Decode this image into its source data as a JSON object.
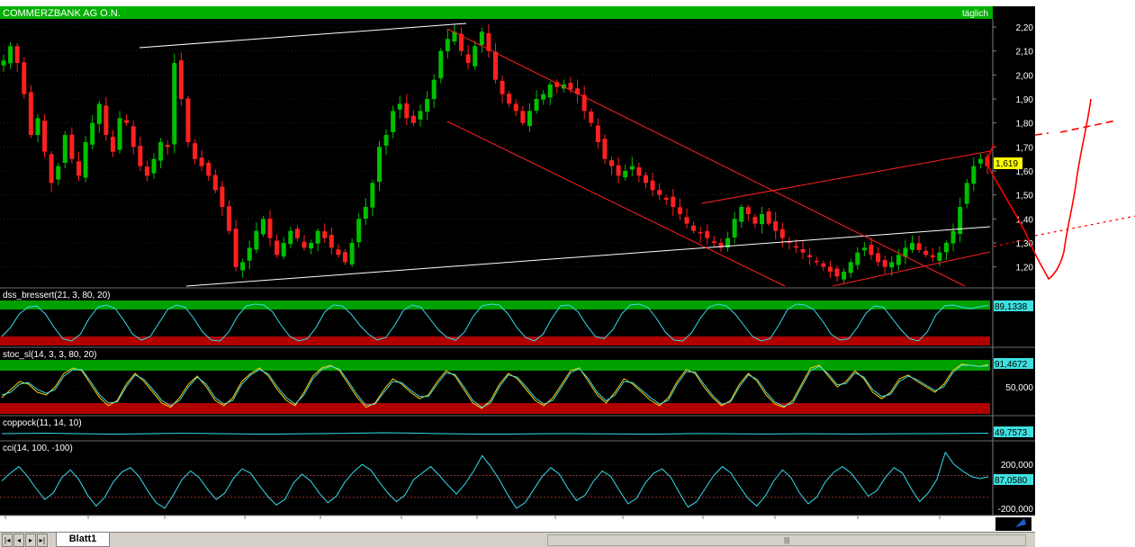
{
  "window": {
    "symbol": "COMMERZBANK AG O.N.",
    "period": "täglich"
  },
  "colors": {
    "background": "#000000",
    "up_candle": "#00c000",
    "down_candle": "#ff2020",
    "trend_red": "#ff2020",
    "trend_white": "#ffffff",
    "indicator": "#33ddee",
    "zone_green": "#00a000",
    "zone_red": "#b00000",
    "header": "#00c000",
    "handdrawn": "#ff0000"
  },
  "chart_data": [
    {
      "type": "candlestick",
      "title": "COMMERZBANK AG O.N.",
      "x_labels": [
        "11",
        "Okt",
        "Nov",
        "Dez",
        "'12",
        "Feb",
        "Mrz",
        "Apr",
        "Mai",
        "Jun",
        "Jul",
        "Aug",
        "Sep"
      ],
      "y_ticks": [
        "2,20",
        "2,10",
        "2,00",
        "1,90",
        "1,80",
        "1,70",
        "1,60",
        "1,50",
        "1,40",
        "1,30",
        "1,20"
      ],
      "ylim": [
        1.12,
        2.23
      ],
      "last_value": "1,619",
      "close_series": [
        2.06,
        2.12,
        2.05,
        1.92,
        1.75,
        1.82,
        1.68,
        1.55,
        1.62,
        1.75,
        1.65,
        1.58,
        1.72,
        1.8,
        1.88,
        1.75,
        1.68,
        1.82,
        1.8,
        1.7,
        1.62,
        1.58,
        1.65,
        1.72,
        1.7,
        2.05,
        1.9,
        1.72,
        1.65,
        1.62,
        1.58,
        1.52,
        1.45,
        1.35,
        1.2,
        1.22,
        1.28,
        1.35,
        1.4,
        1.32,
        1.25,
        1.3,
        1.35,
        1.32,
        1.28,
        1.3,
        1.35,
        1.32,
        1.28,
        1.25,
        1.22,
        1.3,
        1.4,
        1.45,
        1.55,
        1.7,
        1.75,
        1.85,
        1.88,
        1.82,
        1.8,
        1.85,
        1.9,
        1.98,
        2.1,
        2.15,
        2.18,
        2.1,
        2.05,
        2.12,
        2.18,
        2.1,
        1.98,
        1.92,
        1.88,
        1.85,
        1.8,
        1.85,
        1.9,
        1.92,
        1.96,
        1.95,
        1.96,
        1.94,
        1.92,
        1.85,
        1.8,
        1.72,
        1.65,
        1.62,
        1.58,
        1.6,
        1.62,
        1.58,
        1.55,
        1.52,
        1.5,
        1.48,
        1.45,
        1.42,
        1.38,
        1.35,
        1.34,
        1.32,
        1.3,
        1.28,
        1.32,
        1.4,
        1.45,
        1.42,
        1.38,
        1.42,
        1.38,
        1.35,
        1.32,
        1.3,
        1.28,
        1.26,
        1.24,
        1.22,
        1.2,
        1.18,
        1.16,
        1.18,
        1.22,
        1.26,
        1.28,
        1.25,
        1.22,
        1.2,
        1.22,
        1.25,
        1.28,
        1.3,
        1.27,
        1.25,
        1.24,
        1.26,
        1.3,
        1.35,
        1.45,
        1.55,
        1.62,
        1.65,
        1.62
      ],
      "trendlines_white": [
        {
          "from": [
            "Sep",
            2.1
          ],
          "to": [
            "Feb",
            2.21
          ]
        },
        {
          "from": [
            "Nov",
            1.14
          ],
          "to": [
            "Sep",
            1.36
          ]
        }
      ],
      "trendlines_red": [
        {
          "from": [
            "Feb",
            2.2
          ],
          "to": [
            "Sep",
            1.15
          ]
        },
        {
          "from": [
            "Feb",
            1.8
          ],
          "to": [
            "Jul",
            1.14
          ]
        },
        {
          "from": [
            "Mai",
            1.3
          ],
          "to": [
            "Sep",
            1.68
          ]
        },
        {
          "from": [
            "Jul",
            1.14
          ],
          "to": [
            "Sep",
            1.25
          ]
        }
      ]
    },
    {
      "type": "line",
      "title": "dss_bressert(21, 3, 80, 20)",
      "last_value": "89,1338",
      "ylim": [
        0,
        100
      ],
      "zones": [
        80,
        20
      ],
      "values": [
        20,
        40,
        70,
        85,
        88,
        70,
        40,
        15,
        10,
        25,
        60,
        85,
        90,
        82,
        55,
        25,
        12,
        20,
        50,
        80,
        90,
        85,
        60,
        30,
        12,
        10,
        30,
        65,
        88,
        92,
        90,
        75,
        45,
        20,
        10,
        15,
        40,
        75,
        90,
        88,
        70,
        45,
        25,
        12,
        18,
        45,
        78,
        90,
        85,
        60,
        35,
        18,
        12,
        30,
        65,
        88,
        92,
        90,
        70,
        40,
        18,
        10,
        25,
        60,
        88,
        90,
        75,
        45,
        20,
        15,
        35,
        70,
        90,
        92,
        85,
        60,
        30,
        12,
        10,
        28,
        60,
        85,
        92,
        88,
        70,
        45,
        20,
        10,
        15,
        45,
        80,
        92,
        90,
        80,
        55,
        25,
        12,
        15,
        40,
        72,
        88,
        85,
        60,
        35,
        15,
        10,
        30,
        68,
        88,
        90,
        85,
        82,
        86,
        89
      ]
    },
    {
      "type": "line",
      "title": "stoc_sl(14, 3, 3, 80, 20)",
      "last_value": "91,4672",
      "y_ticks": [
        "50,000"
      ],
      "ylim": [
        0,
        100
      ],
      "zones": [
        80,
        20
      ],
      "series_a": [
        30,
        45,
        60,
        55,
        40,
        35,
        50,
        75,
        85,
        80,
        55,
        30,
        15,
        25,
        55,
        75,
        60,
        40,
        20,
        12,
        30,
        55,
        70,
        50,
        25,
        15,
        30,
        60,
        75,
        85,
        70,
        45,
        25,
        15,
        40,
        70,
        85,
        90,
        80,
        55,
        30,
        12,
        20,
        45,
        65,
        55,
        40,
        28,
        35,
        60,
        80,
        70,
        45,
        20,
        10,
        25,
        55,
        75,
        65,
        45,
        25,
        15,
        30,
        55,
        80,
        85,
        60,
        35,
        20,
        40,
        65,
        55,
        40,
        25,
        15,
        30,
        60,
        82,
        75,
        50,
        30,
        15,
        25,
        55,
        75,
        60,
        35,
        18,
        12,
        25,
        55,
        85,
        90,
        70,
        50,
        60,
        80,
        65,
        40,
        28,
        40,
        65,
        72,
        60,
        50,
        40,
        55,
        80,
        92,
        90,
        88,
        91
      ],
      "series_b": [
        35,
        40,
        55,
        58,
        45,
        38,
        45,
        70,
        82,
        82,
        60,
        35,
        20,
        22,
        50,
        72,
        64,
        45,
        25,
        15,
        25,
        50,
        68,
        55,
        30,
        18,
        25,
        55,
        72,
        82,
        74,
        50,
        30,
        18,
        35,
        65,
        82,
        88,
        83,
        60,
        35,
        16,
        18,
        40,
        60,
        58,
        44,
        32,
        32,
        55,
        76,
        73,
        50,
        25,
        12,
        20,
        50,
        72,
        68,
        50,
        30,
        18,
        25,
        50,
        76,
        84,
        65,
        40,
        24,
        35,
        60,
        58,
        44,
        30,
        18,
        25,
        55,
        78,
        78,
        55,
        34,
        18,
        22,
        50,
        72,
        64,
        40,
        22,
        14,
        20,
        50,
        80,
        88,
        74,
        54,
        56,
        76,
        68,
        45,
        32,
        36,
        60,
        70,
        63,
        53,
        43,
        50,
        76,
        90,
        90,
        88,
        89
      ]
    },
    {
      "type": "line",
      "title": "coppock(11, 14, 10)",
      "last_value": "49,7573",
      "values": [
        50,
        50.2,
        50.4,
        50.1,
        49.8,
        49.6,
        49.8,
        50.1,
        50.3,
        50.2,
        49.9,
        49.7,
        49.6,
        49.8,
        50.0,
        50.2,
        50.5,
        50.8,
        50.6,
        50.2,
        49.9,
        49.7,
        49.6,
        49.7,
        49.9,
        50.0,
        49.9,
        49.8,
        49.7,
        49.6,
        49.8,
        50.1,
        50.0,
        49.8,
        49.7,
        49.8,
        49.9,
        49.8,
        49.7,
        49.8,
        49.9,
        50.0,
        50.1,
        50.2,
        50.4
      ]
    },
    {
      "type": "line",
      "title": "cci(14, 100, -100)",
      "last_value": "87,0580",
      "y_ticks": [
        "200,000",
        "-200,000"
      ],
      "ylim": [
        -250,
        300
      ],
      "zones": [
        100,
        -100
      ],
      "values": [
        50,
        120,
        180,
        90,
        -20,
        -120,
        -60,
        80,
        150,
        60,
        -80,
        -180,
        -100,
        40,
        130,
        170,
        90,
        -40,
        -150,
        -200,
        -80,
        60,
        140,
        80,
        -30,
        -120,
        -60,
        70,
        160,
        120,
        10,
        -90,
        -170,
        -120,
        30,
        110,
        50,
        -60,
        -150,
        -90,
        40,
        130,
        200,
        150,
        40,
        -60,
        -140,
        -80,
        60,
        120,
        180,
        100,
        10,
        -70,
        20,
        140,
        280,
        180,
        60,
        -80,
        -200,
        -150,
        -30,
        90,
        170,
        110,
        -20,
        -130,
        -80,
        50,
        140,
        90,
        -40,
        -160,
        -110,
        30,
        120,
        160,
        80,
        -60,
        -190,
        -140,
        -20,
        100,
        180,
        120,
        0,
        -110,
        -180,
        -90,
        50,
        150,
        80,
        -60,
        -160,
        -100,
        40,
        130,
        180,
        120,
        20,
        -90,
        -40,
        80,
        170,
        120,
        -20,
        -140,
        -60,
        60,
        310,
        200,
        140,
        90,
        70,
        87
      ]
    }
  ]
}
